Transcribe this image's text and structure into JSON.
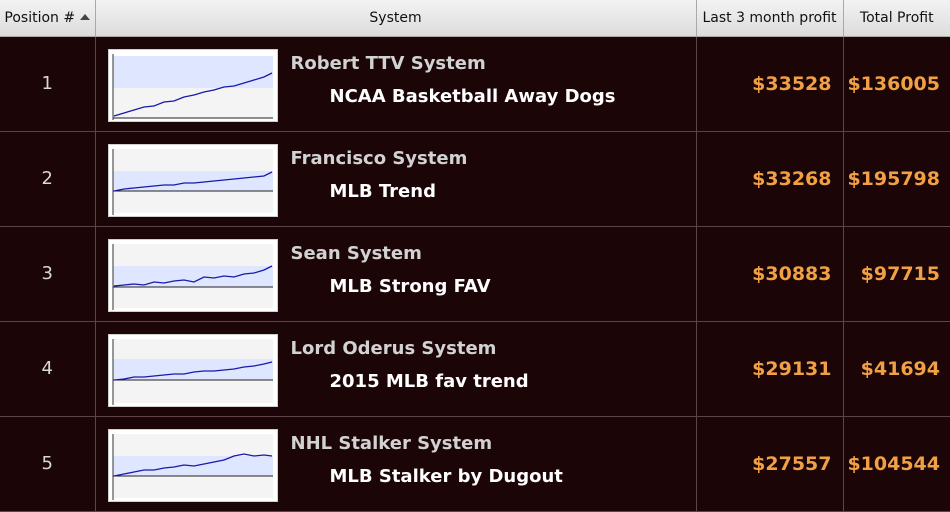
{
  "header": {
    "position_label": "Position #",
    "system_label": "System",
    "last3_label": "Last 3 month profit",
    "total_label": "Total Profit"
  },
  "rows": [
    {
      "position": "1",
      "system": "Robert TTV System",
      "subsystem": "NCAA Basketball Away Dogs",
      "last3": "$33528",
      "total": "$136005"
    },
    {
      "position": "2",
      "system": "Francisco System",
      "subsystem": "MLB Trend",
      "last3": "$33268",
      "total": "$195798"
    },
    {
      "position": "3",
      "system": "Sean System",
      "subsystem": "MLB Strong FAV",
      "last3": "$30883",
      "total": "$97715"
    },
    {
      "position": "4",
      "system": "Lord Oderus System",
      "subsystem": "2015 MLB fav trend",
      "last3": "$29131",
      "total": "$41694"
    },
    {
      "position": "5",
      "system": "NHL Stalker System",
      "subsystem": "MLB Stalker by Dugout",
      "last3": "$27557",
      "total": "$104544"
    }
  ],
  "colors": {
    "background": "#1b0507",
    "money": "#f2a044",
    "sparkline": "#1a1aa8",
    "band": "#dfe6ff"
  },
  "icons": {
    "sort": "sort-ascending-icon"
  }
}
